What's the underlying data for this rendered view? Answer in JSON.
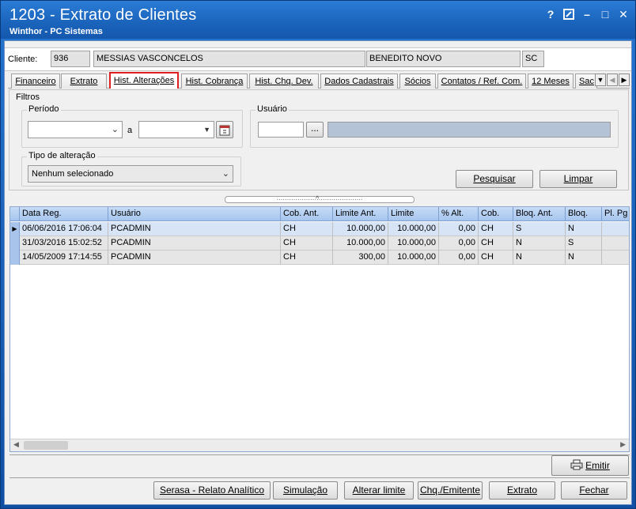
{
  "window": {
    "title": "1203 - Extrato de Clientes",
    "subtitle": "Winthor - PC Sistemas",
    "controls": {
      "help": "?",
      "restore_icon": "edit-window-icon",
      "minimize": "–",
      "maximize": "□",
      "close": "✕"
    }
  },
  "client": {
    "label": "Cliente:",
    "code": "936",
    "name": "MESSIAS VASCONCELOS",
    "city": "BENEDITO NOVO",
    "state": "SC"
  },
  "tabs": [
    {
      "label": "Financeiro"
    },
    {
      "label": "Extrato"
    },
    {
      "label": "Hist. Alterações",
      "active": true
    },
    {
      "label": "Hist. Cobrança"
    },
    {
      "label": "Hist. Chq. Dev."
    },
    {
      "label": "Dados Cadastrais"
    },
    {
      "label": "Sócios"
    },
    {
      "label": "Contatos / Ref. Com."
    },
    {
      "label": "12 Meses"
    },
    {
      "label": "Sac"
    }
  ],
  "filters": {
    "title": "Filtros",
    "period_label": "Período",
    "period_sep": "a",
    "period_start": "",
    "period_end": "",
    "user_label": "Usuário",
    "user_code": "",
    "user_browse": "...",
    "user_name": "",
    "change_type_label": "Tipo de alteração",
    "change_type_value": "Nenhum selecionado",
    "search_button": "Pesquisar",
    "clear_button": "Limpar"
  },
  "grid": {
    "columns": [
      "Data Reg.",
      "Usuário",
      "Cob. Ant.",
      "Limite Ant.",
      "Limite",
      "% Alt.",
      "Cob.",
      "Bloq. Ant.",
      "Bloq.",
      "Pl. Pg"
    ],
    "rows": [
      [
        "06/06/2016 17:06:04",
        "PCADMIN",
        "CH",
        "10.000,00",
        "10.000,00",
        "0,00",
        "CH",
        "S",
        "N",
        ""
      ],
      [
        "31/03/2016 15:02:52",
        "PCADMIN",
        "CH",
        "10.000,00",
        "10.000,00",
        "0,00",
        "CH",
        "N",
        "S",
        ""
      ],
      [
        "14/05/2009 17:14:55",
        "PCADMIN",
        "CH",
        "300,00",
        "10.000,00",
        "0,00",
        "CH",
        "N",
        "N",
        ""
      ]
    ]
  },
  "actions": {
    "print": "Emitir",
    "serasa": "Serasa - Relato Analítico",
    "simulation": "Simulação",
    "change_limit": "Alterar limite",
    "check_issuer": "Chq./Emitente",
    "statement": "Extrato",
    "close": "Fechar"
  }
}
